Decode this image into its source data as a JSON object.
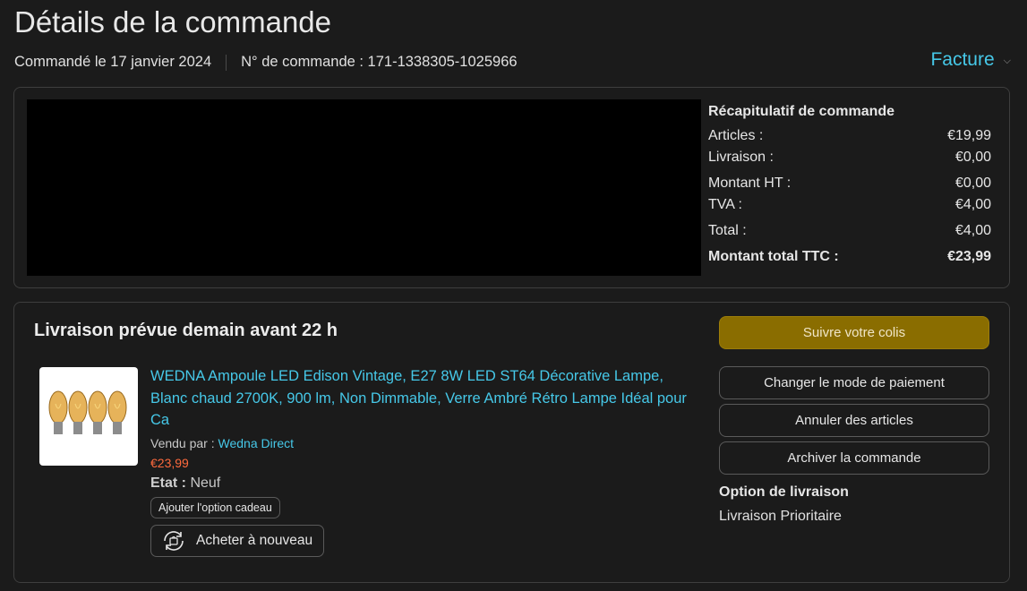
{
  "header": {
    "title": "Détails de la commande",
    "ordered_on": "Commandé le 17 janvier 2024",
    "order_number": "N° de commande : 171-1338305-1025966",
    "invoice_label": "Facture"
  },
  "summary": {
    "title": "Récapitulatif de commande",
    "rows": [
      {
        "label": "Articles :",
        "value": "€19,99"
      },
      {
        "label": "Livraison :",
        "value": "€0,00"
      },
      {
        "label": "Montant HT :",
        "value": "€0,00"
      },
      {
        "label": "TVA :",
        "value": "€4,00"
      },
      {
        "label": "Total :",
        "value": "€4,00"
      }
    ],
    "grand_total_label": "Montant total TTC :",
    "grand_total_value": "€23,99"
  },
  "shipment": {
    "title": "Livraison prévue demain avant 22 h",
    "product": {
      "name": "WEDNA Ampoule LED Edison Vintage, E27 8W LED ST64 Décorative Lampe, Blanc chaud 2700K, 900 lm, Non Dimmable, Verre Ambré Rétro Lampe Idéal pour Ca",
      "sold_by_label": "Vendu par :",
      "seller": "Wedna Direct",
      "price": "€23,99",
      "condition_label": "Etat :",
      "condition": "Neuf",
      "gift_label": "Ajouter l'option cadeau",
      "rebuy_label": "Acheter à nouveau"
    },
    "actions": {
      "track": "Suivre votre colis",
      "change_payment": "Changer le mode de paiement",
      "cancel_items": "Annuler des articles",
      "archive": "Archiver la commande"
    },
    "delivery_option_title": "Option de livraison",
    "delivery_option_value": "Livraison Prioritaire"
  },
  "colors": {
    "link": "#46c8e8",
    "price": "#ff6a3d",
    "primary_button": "#8a6d00",
    "background": "#1b1b1b"
  },
  "icons": {
    "invoice_dropdown": "chevron-down-icon",
    "rebuy": "rebuy-cycle-icon"
  }
}
